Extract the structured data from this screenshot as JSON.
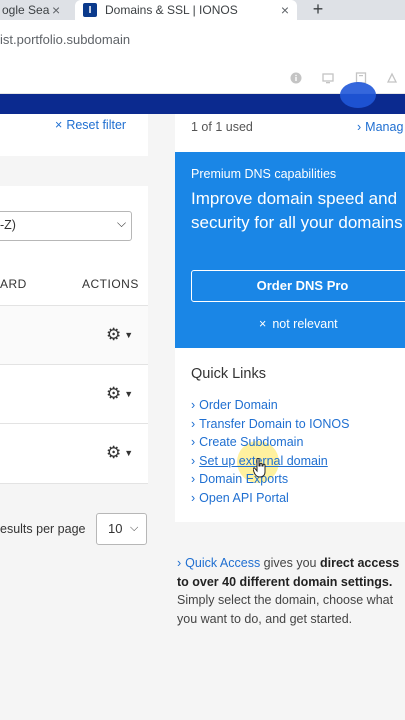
{
  "browser": {
    "tab1_title": "ogle Sea",
    "tab2_title": "Domains & SSL | IONOS",
    "tab_close": "×",
    "new_tab": "+",
    "url": "ist.portfolio.subdomain"
  },
  "left": {
    "reset_filter": "Reset filter",
    "sort_value": "-Z)",
    "col_dashboard": "ARD",
    "col_actions": "ACTIONS",
    "results_label": "esults per page",
    "per_page": "10"
  },
  "right": {
    "used": "1 of 1 used",
    "manage": "Manag",
    "dns_small": "Premium DNS capabilities",
    "dns_big": "Improve domain speed and security for all your domains",
    "order_button": "Order DNS Pro",
    "not_relevant": "not relevant",
    "quick_links_title": "Quick Links",
    "quick_links": [
      "Order Domain",
      "Transfer Domain to IONOS",
      "Create Subdomain",
      "Set up external domain",
      "Domain Exports",
      "Open API Portal"
    ],
    "qa_link": "Quick Access",
    "qa_text1": " gives you ",
    "qa_bold": "direct access to over 40 different domain settings.",
    "qa_text2": " Simply select the domain, choose what you want to do, and get started."
  },
  "colors": {
    "brand_blue": "#1a86e6",
    "nav_dark": "#0b2a8f",
    "link": "#1f6fd1"
  },
  "icons": {
    "gear": "gear-icon",
    "chevron": "chevron-right-icon",
    "close": "close-icon"
  }
}
